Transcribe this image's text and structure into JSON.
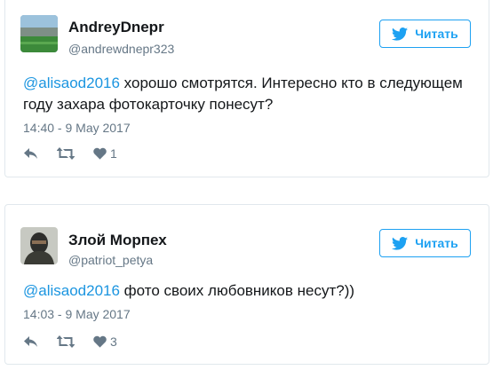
{
  "tweets": [
    {
      "name": "AndreyDnepr",
      "handle": "@andrewdnepr323",
      "follow_label": "Читать",
      "mention": "@alisaod2016",
      "text": " хорошо смотрятся. Интересно кто в следующем году захара фотокарточку понесут?",
      "time": "14:40 - 9 May 2017",
      "likes": "1",
      "avatar_icon": "stadium-avatar"
    },
    {
      "name": "Злой Морпех",
      "handle": "@patriot_petya",
      "follow_label": "Читать",
      "mention": "@alisaod2016",
      "text": " фото своих любовников несут?))",
      "time": "14:03 - 9 May 2017",
      "likes": "3",
      "avatar_icon": "masked-person-avatar"
    }
  ],
  "icons": {
    "follow": "twitter-bird-icon",
    "reply": "reply-icon",
    "retweet": "retweet-icon",
    "like": "heart-icon"
  },
  "colors": {
    "accent": "#1da1f2",
    "mention": "#1b95e0",
    "muted": "#657786",
    "border": "#e1e8ed"
  }
}
